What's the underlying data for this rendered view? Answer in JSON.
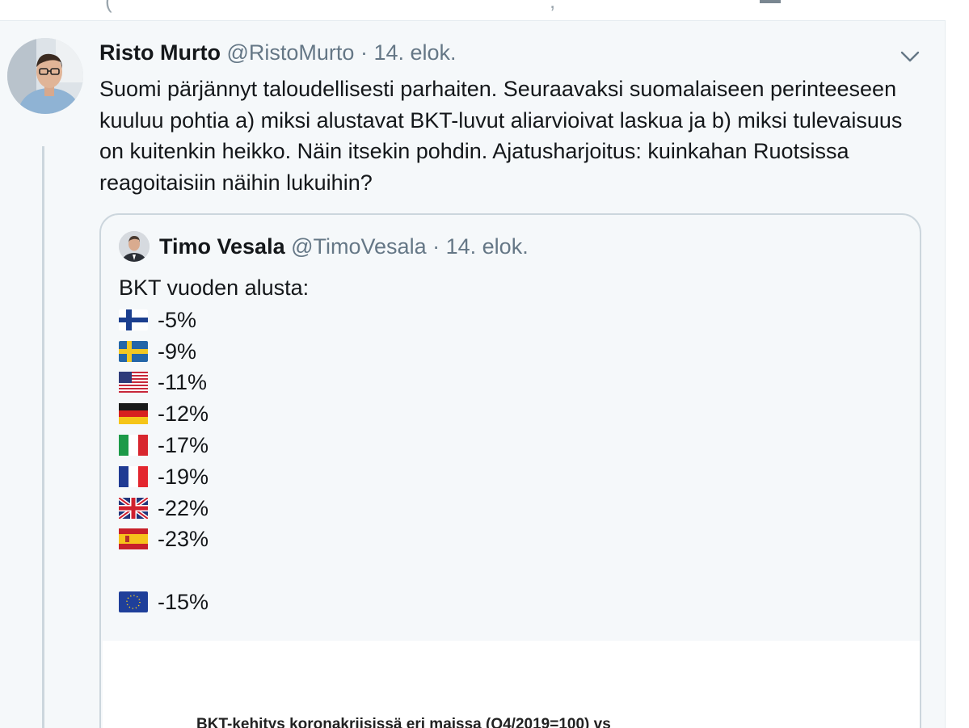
{
  "tweet": {
    "author_name": "Risto Murto",
    "author_handle": "@RistoMurto",
    "separator": "·",
    "date": "14. elok.",
    "text": "Suomi pärjännyt taloudellisesti parhaiten. Seuraavaksi suomalaiseen perinteeseen kuuluu pohtia a) miksi alustavat BKT-luvut aliarvioivat laskua ja b) miksi tulevaisuus on kuitenkin heikko. Näin itsekin pohdin. Ajatusharjoitus: kuinkahan Ruotsissa reagoitaisiin näihin lukuihin?"
  },
  "quote": {
    "author_name": "Timo Vesala",
    "author_handle": "@TimoVesala",
    "separator": "·",
    "date": "14. elok.",
    "intro": "BKT vuoden alusta:",
    "rows": [
      {
        "flag": "finland-flag-icon",
        "value": "-5%"
      },
      {
        "flag": "sweden-flag-icon",
        "value": "-9%"
      },
      {
        "flag": "usa-flag-icon",
        "value": "-11%"
      },
      {
        "flag": "germany-flag-icon",
        "value": "-12%"
      },
      {
        "flag": "italy-flag-icon",
        "value": "-17%"
      },
      {
        "flag": "france-flag-icon",
        "value": "-19%"
      },
      {
        "flag": "uk-flag-icon",
        "value": "-22%"
      },
      {
        "flag": "spain-flag-icon",
        "value": "-23%"
      },
      {
        "flag": "eu-flag-icon",
        "value": "-15%"
      }
    ],
    "media_caption": "BKT-kehitys koronakriisissä eri maissa (Q4/2019=100) vs"
  },
  "colors": {
    "name": "#14171a",
    "muted": "#657786",
    "border": "#ccd6dd",
    "background": "#f5f8fa"
  }
}
